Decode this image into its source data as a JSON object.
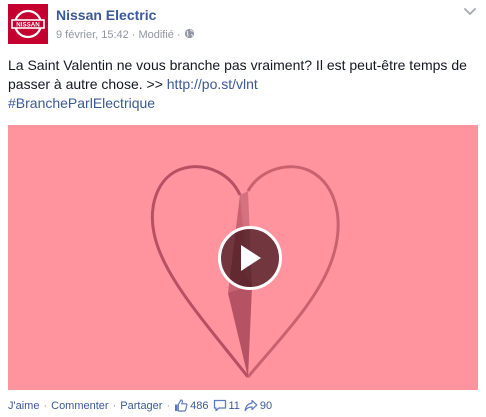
{
  "post": {
    "author": "Nissan Electric",
    "logo_text": "NISSAN",
    "date": "9 février, 15:42",
    "separator": "·",
    "modified": "Modifié",
    "audience_icon": "globe-icon",
    "menu_icon": "chevron-down-icon",
    "text_main": "La Saint Valentin ne vous branche pas vraiment? Il est peut-être temps de passer à autre chose. >> ",
    "link": "http://po.st/vlnt",
    "hashtag": "#BrancheParlElectrique"
  },
  "media": {
    "background_color": "#ff949f",
    "heart_color": "#c05a69",
    "play_icon": "play-icon"
  },
  "actions": {
    "like": "J'aime",
    "comment": "Commenter",
    "share": "Partager",
    "dot": "·",
    "likes_count": "486",
    "comments_count": "11",
    "shares_count": "90",
    "like_icon": "thumbs-up-icon",
    "comment_icon": "comment-icon",
    "share_icon": "share-icon"
  },
  "colors": {
    "brand": "#c3002f",
    "link": "#3b5998",
    "meta": "#9197a3"
  }
}
